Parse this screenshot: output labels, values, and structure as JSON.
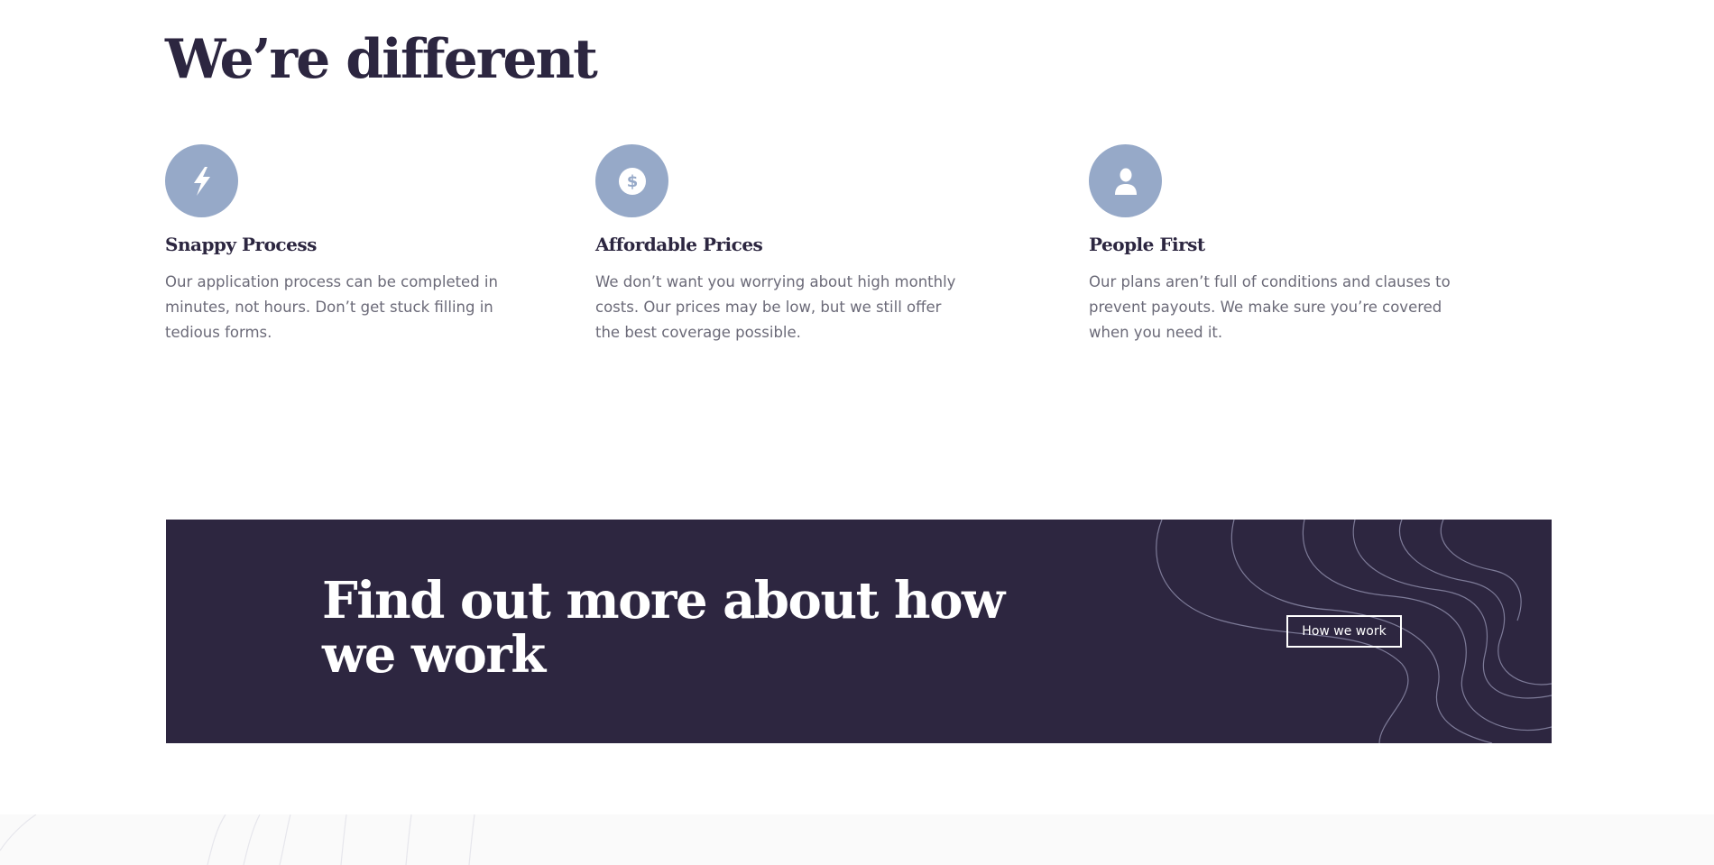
{
  "section": {
    "title": "We’re different"
  },
  "features": [
    {
      "icon": "lightning-icon",
      "heading": "Snappy Process",
      "text": "Our application process can be completed in minutes, not hours. Don’t get stuck filling in tedious forms."
    },
    {
      "icon": "dollar-icon",
      "heading": "Affordable Prices",
      "text": "We don’t want you worrying about high monthly costs. Our prices may be low, but we still offer the best coverage possible."
    },
    {
      "icon": "person-icon",
      "heading": "People First",
      "text": "Our plans aren’t full of conditions and clauses to prevent payouts. We make sure you’re covered when you need it."
    }
  ],
  "cta": {
    "title": "Find out more about how we work",
    "button_label": "How we work"
  },
  "colors": {
    "dark": "#2c2640",
    "icon_bg": "#96a9c8",
    "body_text": "#6b6a78",
    "footer_bg": "#fafafa"
  }
}
